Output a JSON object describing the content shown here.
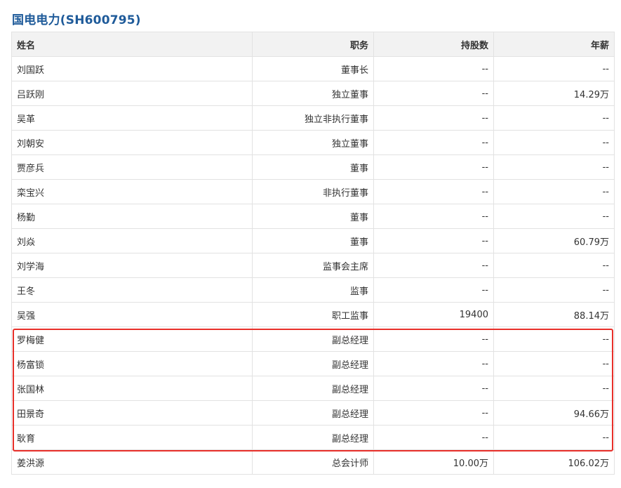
{
  "title": "国电电力(SH600795)",
  "table": {
    "headers": {
      "name": "姓名",
      "position": "职务",
      "shares": "持股数",
      "salary": "年薪"
    },
    "rows": [
      {
        "name": "刘国跃",
        "position": "董事长",
        "shares": "--",
        "salary": "--"
      },
      {
        "name": "吕跃刚",
        "position": "独立董事",
        "shares": "--",
        "salary": "14.29万"
      },
      {
        "name": "吴革",
        "position": "独立非执行董事",
        "shares": "--",
        "salary": "--"
      },
      {
        "name": "刘朝安",
        "position": "独立董事",
        "shares": "--",
        "salary": "--"
      },
      {
        "name": "贾彦兵",
        "position": "董事",
        "shares": "--",
        "salary": "--"
      },
      {
        "name": "栾宝兴",
        "position": "非执行董事",
        "shares": "--",
        "salary": "--"
      },
      {
        "name": "杨勤",
        "position": "董事",
        "shares": "--",
        "salary": "--"
      },
      {
        "name": "刘焱",
        "position": "董事",
        "shares": "--",
        "salary": "60.79万"
      },
      {
        "name": "刘学海",
        "position": "监事会主席",
        "shares": "--",
        "salary": "--"
      },
      {
        "name": "王冬",
        "position": "监事",
        "shares": "--",
        "salary": "--"
      },
      {
        "name": "吴强",
        "position": "职工监事",
        "shares": "19400",
        "salary": "88.14万"
      },
      {
        "name": "罗梅健",
        "position": "副总经理",
        "shares": "--",
        "salary": "--"
      },
      {
        "name": "杨富锁",
        "position": "副总经理",
        "shares": "--",
        "salary": "--"
      },
      {
        "name": "张国林",
        "position": "副总经理",
        "shares": "--",
        "salary": "--"
      },
      {
        "name": "田景奇",
        "position": "副总经理",
        "shares": "--",
        "salary": "94.66万"
      },
      {
        "name": "耿育",
        "position": "副总经理",
        "shares": "--",
        "salary": "--"
      },
      {
        "name": "姜洪源",
        "position": "总会计师",
        "shares": "10.00万",
        "salary": "106.02万"
      }
    ]
  },
  "colors": {
    "title": "#1f5b9a",
    "header_bg": "#f2f2f2",
    "border": "#e2e2e2",
    "highlight": "#e8302a"
  }
}
